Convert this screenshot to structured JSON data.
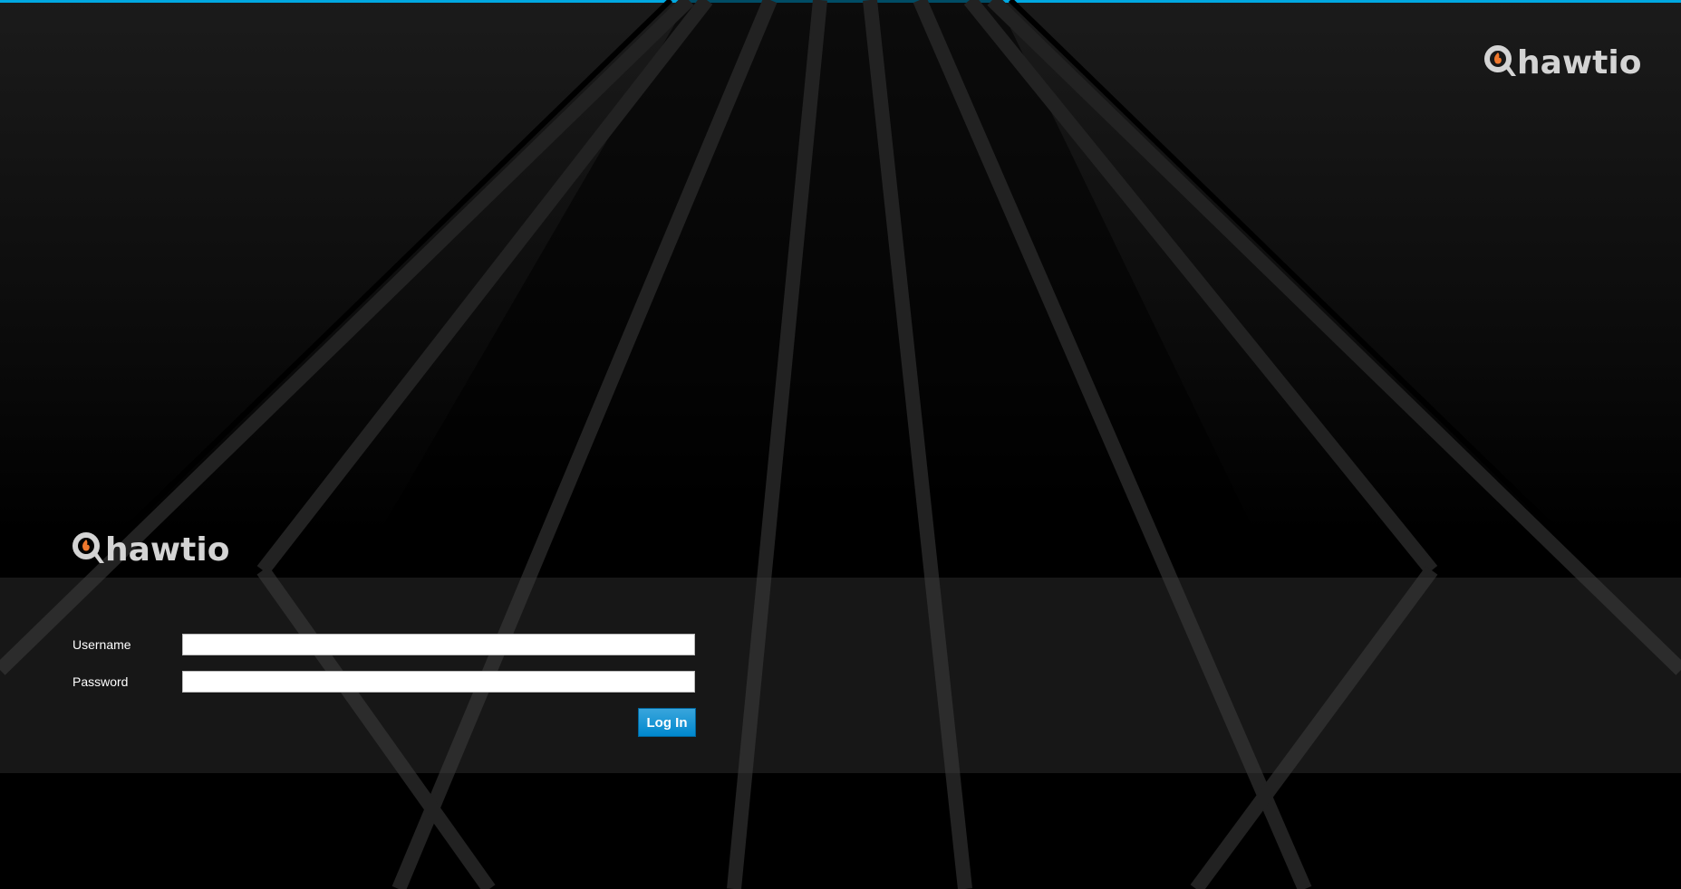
{
  "header": {
    "logo_text": "hawtio",
    "logo_icon": "hawtio-flame-q-icon"
  },
  "login": {
    "logo_text": "hawtio",
    "logo_icon": "hawtio-flame-q-icon",
    "username_label": "Username",
    "username_value": "",
    "password_label": "Password",
    "password_value": "",
    "submit_label": "Log In"
  },
  "colors": {
    "accent": "#00a8e1",
    "button": "#0088ce",
    "logo_text": "#d4d4d4",
    "flame": "#f0782d"
  }
}
